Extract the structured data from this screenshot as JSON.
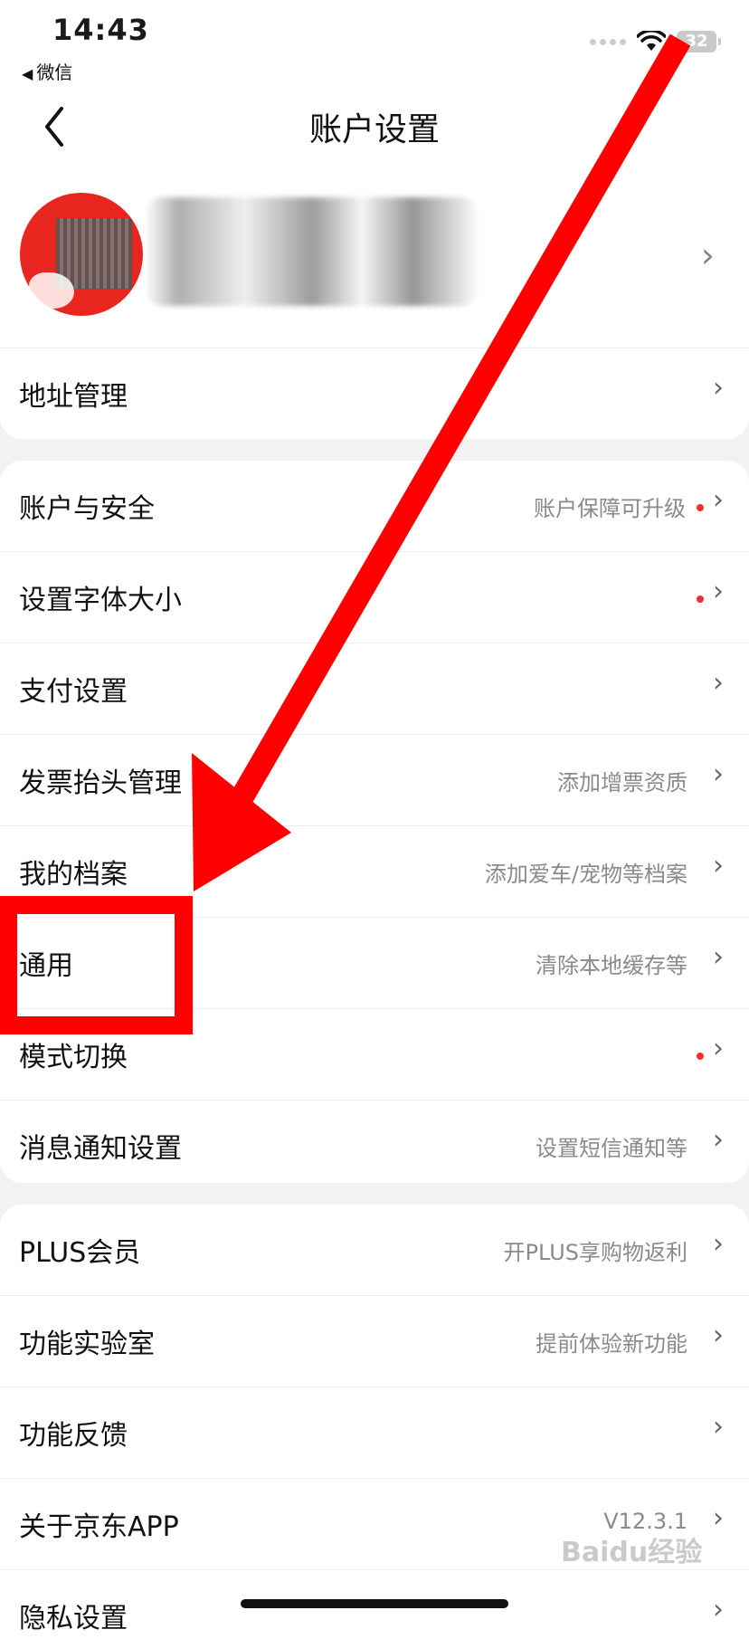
{
  "status_bar": {
    "time": "14:43",
    "back_label": "微信",
    "battery": "32"
  },
  "nav": {
    "title": "账户设置"
  },
  "groups": [
    {
      "rows": [
        {
          "label": "地址管理",
          "value": "",
          "dot": false
        }
      ]
    },
    {
      "rows": [
        {
          "label": "账户与安全",
          "value": "账户保障可升级",
          "dot": true
        },
        {
          "label": "设置字体大小",
          "value": "",
          "dot": true
        },
        {
          "label": "支付设置",
          "value": "",
          "dot": false
        },
        {
          "label": "发票抬头管理",
          "value": "添加增票资质",
          "dot": false
        },
        {
          "label": "我的档案",
          "value": "添加爱车/宠物等档案",
          "dot": false
        },
        {
          "label": "通用",
          "value": "清除本地缓存等",
          "dot": false
        },
        {
          "label": "模式切换",
          "value": "",
          "dot": true
        },
        {
          "label": "消息通知设置",
          "value": "设置短信通知等",
          "dot": false
        }
      ]
    },
    {
      "rows": [
        {
          "label": "PLUS会员",
          "value": "开PLUS享购物返利",
          "dot": false
        },
        {
          "label": "功能实验室",
          "value": "提前体验新功能",
          "dot": false
        },
        {
          "label": "功能反馈",
          "value": "",
          "dot": false
        },
        {
          "label": "关于京东APP",
          "value": "V12.3.1",
          "dot": false
        },
        {
          "label": "隐私设置",
          "value": "",
          "dot": false
        }
      ]
    }
  ],
  "colors": {
    "accent_red": "#ff0000",
    "dot_red": "#f23030"
  },
  "icons": {
    "back": "chevron-left-icon",
    "row": "chevron-right-icon"
  },
  "watermark": "Baidu经验"
}
